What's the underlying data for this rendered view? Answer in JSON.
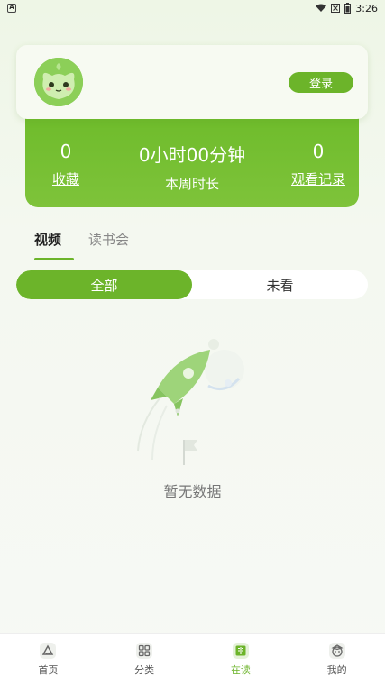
{
  "status_bar": {
    "time": "3:26"
  },
  "profile": {
    "login_label": "登录"
  },
  "stats": {
    "favorites_count": "0",
    "favorites_label": "收藏",
    "week_time": "0小时00分钟",
    "week_time_label": "本周时长",
    "history_count": "0",
    "history_label": "观看记录"
  },
  "tabs": [
    {
      "label": "视频"
    },
    {
      "label": "读书会"
    }
  ],
  "filter": {
    "all_label": "全部",
    "unwatched_label": "未看"
  },
  "empty": {
    "message": "暂无数据"
  },
  "nav": [
    {
      "label": "首页",
      "icon": "home-icon"
    },
    {
      "label": "分类",
      "icon": "category-icon"
    },
    {
      "label": "在读",
      "icon": "reading-icon"
    },
    {
      "label": "我的",
      "icon": "profile-icon"
    }
  ],
  "colors": {
    "accent": "#6cb42a",
    "panel": "#74bf30"
  }
}
